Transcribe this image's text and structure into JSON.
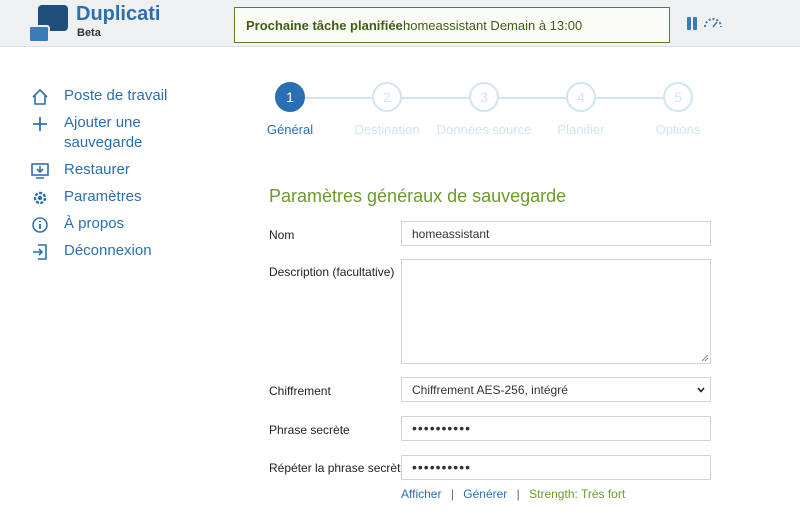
{
  "app": {
    "name": "Duplicati",
    "edition": "Beta"
  },
  "schedule": {
    "label": "Prochaine tâche planifiée :",
    "value": "homeassistant Demain à 13:00"
  },
  "sidebar": {
    "items": [
      {
        "label": "Poste de travail",
        "icon": "home-icon"
      },
      {
        "label": "Ajouter une sauvegarde",
        "icon": "plus-icon"
      },
      {
        "label": "Restaurer",
        "icon": "restore-icon"
      },
      {
        "label": "Paramètres",
        "icon": "gear-icon"
      },
      {
        "label": "À propos",
        "icon": "info-icon"
      },
      {
        "label": "Déconnexion",
        "icon": "logout-icon"
      }
    ]
  },
  "stepper": {
    "steps": [
      {
        "number": "1",
        "label": "Général",
        "active": true
      },
      {
        "number": "2",
        "label": "Destination",
        "active": false
      },
      {
        "number": "3",
        "label": "Données source",
        "active": false
      },
      {
        "number": "4",
        "label": "Planifier",
        "active": false
      },
      {
        "number": "5",
        "label": "Options",
        "active": false
      }
    ]
  },
  "form": {
    "title": "Paramètres généraux de sauvegarde",
    "name_label": "Nom",
    "name_value": "homeassistant",
    "description_label": "Description (facultative)",
    "description_value": "",
    "encryption_label": "Chiffrement",
    "encryption_value": "Chiffrement AES-256, intégré",
    "passphrase_label": "Phrase secrète",
    "passphrase_value": "••••••••••",
    "repeat_label": "Répéter la phrase secrète",
    "repeat_value": "••••••••••",
    "show_link": "Afficher",
    "generate_link": "Générer",
    "strength": "Strength: Très fort",
    "separator": "|"
  },
  "colors": {
    "accent": "#2b6fb3",
    "section_title": "#6c9a2b",
    "schedule_border": "#5a7d2a",
    "step_inactive": "#cfe5f0"
  }
}
